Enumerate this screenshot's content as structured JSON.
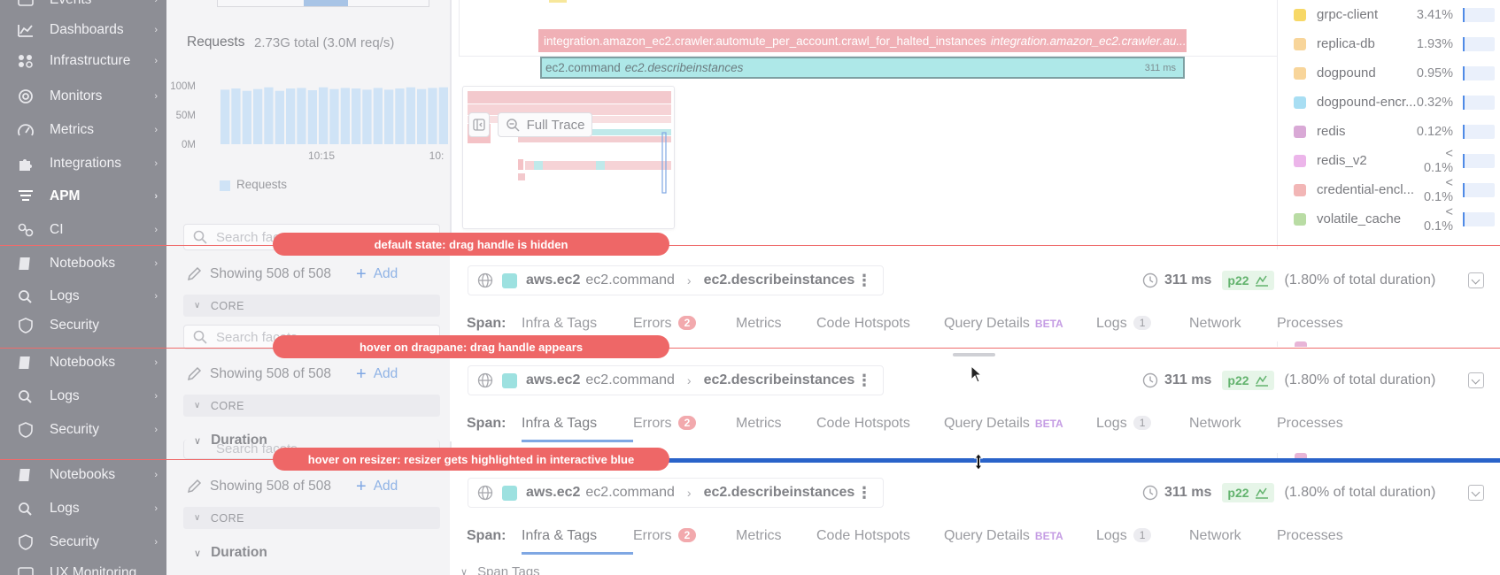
{
  "nav": {
    "items": [
      {
        "label": "Events",
        "icon": "events-icon"
      },
      {
        "label": "Dashboards",
        "icon": "dashboards-icon"
      },
      {
        "label": "Infrastructure",
        "icon": "infrastructure-icon"
      },
      {
        "label": "Monitors",
        "icon": "monitors-icon"
      },
      {
        "label": "Metrics",
        "icon": "metrics-icon"
      },
      {
        "label": "Integrations",
        "icon": "integrations-icon"
      },
      {
        "label": "APM",
        "icon": "apm-icon"
      },
      {
        "label": "CI",
        "icon": "ci-icon"
      },
      {
        "label": "Notebooks",
        "icon": "notebooks-icon"
      },
      {
        "label": "Logs",
        "icon": "logs-icon"
      },
      {
        "label": "Security",
        "icon": "security-icon"
      },
      {
        "label": "UX Monitoring",
        "icon": "ux-monitoring-icon"
      }
    ],
    "arrow": "›"
  },
  "requests": {
    "title": "Requests",
    "total": "2.73G total (3.0M req/s)",
    "legend": "Requests",
    "ytick_100m": "100M",
    "ytick_50m": "50M",
    "ytick_0m": "0M",
    "xtick_1015": "10:15",
    "xtick_next": "10:"
  },
  "facets": {
    "search_placeholder": "Search facets",
    "showing": "Showing 508 of 508",
    "add_label": "Add",
    "core_label": "CORE",
    "duration_label": "Duration"
  },
  "flame": {
    "parent_span_name": "integration.amazon_ec2.crawler.automute_per_account.crawl_for_halted_instances",
    "parent_span_resource": "integration.amazon_ec2.crawler.au...",
    "child_span_name": "ec2.command",
    "child_span_resource": "ec2.describeinstances",
    "child_span_duration": "311 ms"
  },
  "minimap": {
    "full_trace_label": "Full Trace"
  },
  "services": [
    {
      "name": "grpc-client",
      "pct": "3.41%",
      "color": "#f7d867"
    },
    {
      "name": "replica-db",
      "pct": "1.93%",
      "color": "#f8d59a"
    },
    {
      "name": "dogpound",
      "pct": "0.95%",
      "color": "#f8d59a"
    },
    {
      "name": "dogpound-encr...",
      "pct": "0.32%",
      "color": "#a8def3"
    },
    {
      "name": "redis",
      "pct": "0.12%",
      "color": "#d9a9d6"
    },
    {
      "name": "redis_v2",
      "pct": "< 0.1%",
      "color": "#ecb5ea"
    },
    {
      "name": "credential-encl...",
      "pct": "< 0.1%",
      "color": "#f2b6b6"
    },
    {
      "name": "volatile_cache",
      "pct": "< 0.1%",
      "color": "#b9dca4"
    }
  ],
  "span_header": {
    "service": "aws.ec2",
    "operation": "ec2.command",
    "separator": "›",
    "resource": "ec2.describeinstances",
    "duration": "311 ms",
    "percentile": "p22",
    "pct_of_total": "(1.80% of total duration)"
  },
  "tabs": {
    "span_label": "Span:",
    "infra": "Infra & Tags",
    "errors": "Errors",
    "errors_count": "2",
    "metrics": "Metrics",
    "code_hotspots": "Code Hotspots",
    "query_details": "Query Details",
    "beta": "BETA",
    "logs": "Logs",
    "logs_count": "1",
    "network": "Network",
    "processes": "Processes"
  },
  "span_tags_label": "Span Tags",
  "annotations": {
    "default_state": "default state: drag handle is hidden",
    "hover_dragpane": "hover on dragpane: drag handle appears",
    "hover_resizer": "hover on resizer: resizer gets highlighted in interactive blue"
  },
  "colors": {
    "interactive_blue": "#2a63c9",
    "annotation_red": "#ee6767",
    "nav_dimmed": "#8d8e95"
  },
  "chart_data": {
    "type": "bar",
    "title": "Requests",
    "series": [
      {
        "name": "Requests",
        "values": [
          92,
          94,
          90,
          93,
          96,
          90,
          94,
          95,
          91,
          96,
          93,
          95,
          94,
          92,
          95,
          92,
          94,
          96,
          93,
          95,
          96
        ]
      }
    ],
    "ylim": [
      0,
      100
    ],
    "yticks": [
      "0M",
      "50M",
      "100M"
    ],
    "xticks": [
      "10:15",
      "10:"
    ]
  }
}
